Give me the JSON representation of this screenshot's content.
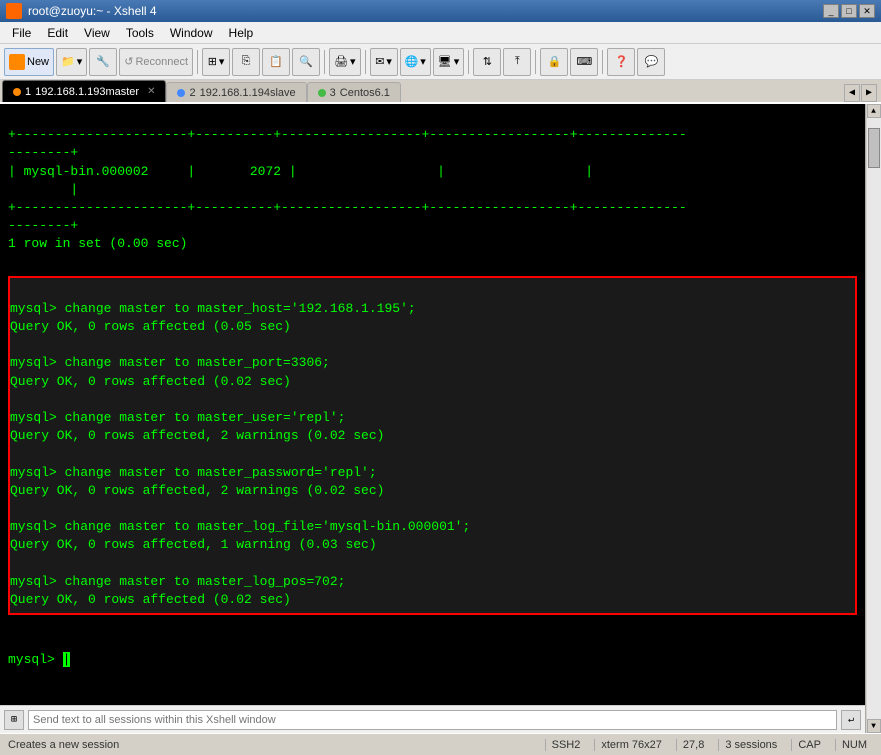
{
  "titlebar": {
    "title": "root@zuoyu:~ - Xshell 4",
    "minimize_label": "_",
    "maximize_label": "□",
    "close_label": "✕"
  },
  "menu": {
    "items": [
      "File",
      "Edit",
      "View",
      "Tools",
      "Window",
      "Help"
    ]
  },
  "toolbar": {
    "new_label": "New",
    "reconnect_label": "Reconnect"
  },
  "tabs": [
    {
      "number": "1",
      "label": "192.168.1.193master",
      "active": true,
      "dot_color": "orange"
    },
    {
      "number": "2",
      "label": "192.168.1.194slave",
      "active": false,
      "dot_color": "blue"
    },
    {
      "number": "3",
      "label": "Centos6.1",
      "active": false,
      "dot_color": "green"
    }
  ],
  "terminal": {
    "lines": [
      "+----------------------+----------+------------------+------------------+",
      "--------+",
      "| mysql-bin.000002 |       2072 |                  |                  |",
      "        |",
      "+----------------------+----------+------------------+------------------+",
      "--------+",
      "1 row in set (0.00 sec)",
      "",
      "mysql> change master to master_host='192.168.1.195';",
      "Query OK, 0 rows affected (0.05 sec)",
      "",
      "mysql> change master to master_port=3306;",
      "Query OK, 0 rows affected (0.02 sec)",
      "",
      "mysql> change master to master_user='repl';",
      "Query OK, 0 rows affected, 2 warnings (0.02 sec)",
      "",
      "mysql> change master to master_password='repl';",
      "Query OK, 0 rows affected, 2 warnings (0.02 sec)",
      "",
      "mysql> change master to master_log_file='mysql-bin.000001';",
      "Query OK, 0 rows affected, 1 warning (0.03 sec)",
      "",
      "mysql> change master to master_log_pos=702;",
      "Query OK, 0 rows affected (0.02 sec)",
      "",
      "mysql> |"
    ]
  },
  "send_bar": {
    "placeholder": "Send text to all sessions within this Xshell window"
  },
  "status_bar": {
    "left": "Creates a new session",
    "ssh": "SSH2",
    "term": "xterm 76x27",
    "pos": "27,8",
    "sessions": "3 sessions",
    "cap": "CAP",
    "num": "NUM"
  }
}
